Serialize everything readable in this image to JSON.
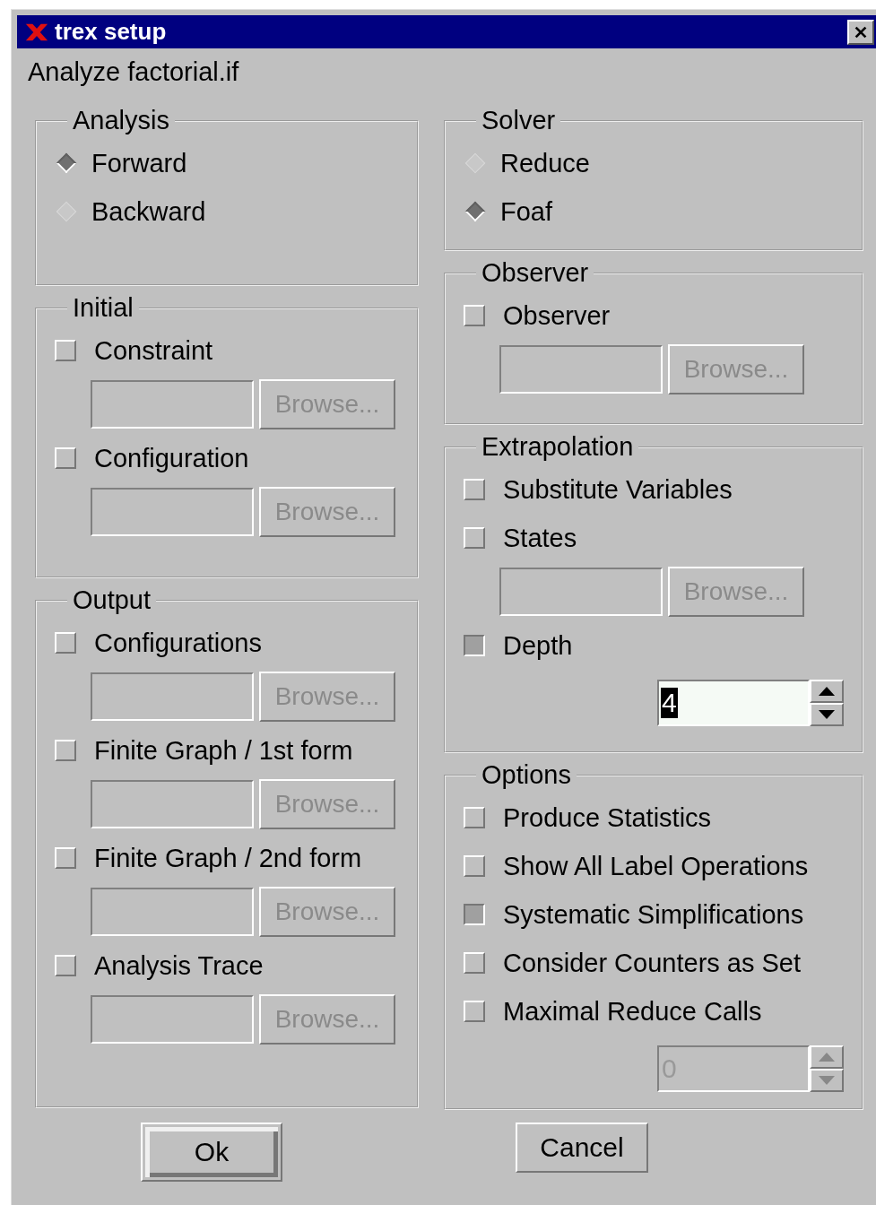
{
  "window": {
    "title": "trex setup",
    "subtitle": "Analyze factorial.if"
  },
  "columns": [
    [
      {
        "title": "Analysis",
        "items": [
          {
            "kind": "radio",
            "label": "Forward",
            "selected": true
          },
          {
            "kind": "radio",
            "label": "Backward",
            "selected": false
          }
        ]
      },
      {
        "title": "Initial",
        "items": [
          {
            "kind": "checkbox",
            "label": "Constraint",
            "checked": false
          },
          {
            "kind": "file",
            "button": "Browse...",
            "disabled": true
          },
          {
            "kind": "checkbox",
            "label": "Configuration",
            "checked": false
          },
          {
            "kind": "file",
            "button": "Browse...",
            "disabled": true
          }
        ]
      },
      {
        "title": "Output",
        "items": [
          {
            "kind": "checkbox",
            "label": "Configurations",
            "checked": false
          },
          {
            "kind": "file",
            "button": "Browse...",
            "disabled": true
          },
          {
            "kind": "checkbox",
            "label": "Finite Graph / 1st form",
            "checked": false
          },
          {
            "kind": "file",
            "button": "Browse...",
            "disabled": true
          },
          {
            "kind": "checkbox",
            "label": "Finite Graph / 2nd form",
            "checked": false
          },
          {
            "kind": "file",
            "button": "Browse...",
            "disabled": true
          },
          {
            "kind": "checkbox",
            "label": "Analysis Trace",
            "checked": false
          },
          {
            "kind": "file",
            "button": "Browse...",
            "disabled": true
          }
        ]
      }
    ],
    [
      {
        "title": "Solver",
        "items": [
          {
            "kind": "radio",
            "label": "Reduce",
            "selected": false
          },
          {
            "kind": "radio",
            "label": "Foaf",
            "selected": true
          }
        ]
      },
      {
        "title": "Observer",
        "items": [
          {
            "kind": "checkbox",
            "label": "Observer",
            "checked": false
          },
          {
            "kind": "file",
            "button": "Browse...",
            "disabled": true
          }
        ]
      },
      {
        "title": "Extrapolation",
        "items": [
          {
            "kind": "checkbox",
            "label": "Substitute Variables",
            "checked": false
          },
          {
            "kind": "checkbox",
            "label": "States",
            "checked": false
          },
          {
            "kind": "file",
            "button": "Browse...",
            "disabled": true
          },
          {
            "kind": "checkbox",
            "label": "Depth",
            "checked": true
          },
          {
            "kind": "spin",
            "value": "4",
            "disabled": false
          }
        ]
      },
      {
        "title": "Options",
        "items": [
          {
            "kind": "checkbox",
            "label": "Produce Statistics",
            "checked": false
          },
          {
            "kind": "checkbox",
            "label": "Show All Label Operations",
            "checked": false
          },
          {
            "kind": "checkbox",
            "label": "Systematic Simplifications",
            "checked": true
          },
          {
            "kind": "checkbox",
            "label": "Consider Counters as Set",
            "checked": false
          },
          {
            "kind": "checkbox",
            "label": "Maximal Reduce Calls",
            "checked": false
          },
          {
            "kind": "spin",
            "value": "0",
            "disabled": true
          }
        ]
      }
    ]
  ],
  "buttons": [
    {
      "label": "Ok",
      "default": true
    },
    {
      "label": "Cancel",
      "default": false
    }
  ]
}
